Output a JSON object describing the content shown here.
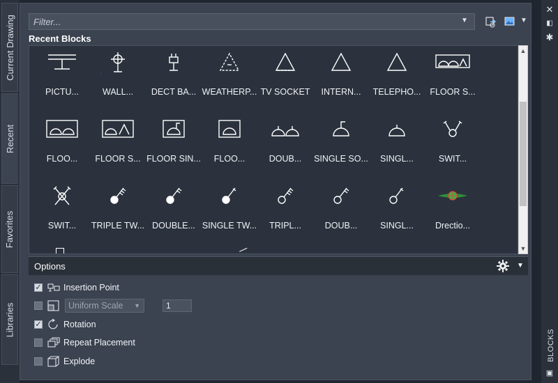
{
  "left_tabs": [
    {
      "label": "Current Drawing",
      "active": false
    },
    {
      "label": "Recent",
      "active": true
    },
    {
      "label": "Favorites",
      "active": false
    },
    {
      "label": "Libraries",
      "active": false
    }
  ],
  "filter": {
    "placeholder": "Filter..."
  },
  "section_title": "Recent Blocks",
  "blocks": [
    {
      "label": "PICTU...",
      "icon": "picture-rail-icon"
    },
    {
      "label": "WALL...",
      "icon": "wall-crosshair-icon"
    },
    {
      "label": "DECT BA...",
      "icon": "dect-base-plug-icon"
    },
    {
      "label": "WEATHERP...",
      "icon": "weatherproof-triangle-icon"
    },
    {
      "label": "TV SOCKET",
      "icon": "tv-socket-triangle-icon"
    },
    {
      "label": "INTERN...",
      "icon": "internet-triangle-icon"
    },
    {
      "label": "TELEPHO...",
      "icon": "telephone-triangle-icon"
    },
    {
      "label": "FLOOR S...",
      "icon": "floor-socket-box-icon"
    },
    {
      "label": "FLOO...",
      "icon": "floor-double-socket-icon"
    },
    {
      "label": "FLOOR S...",
      "icon": "floor-socket-box-icon"
    },
    {
      "label": "FLOOR SIN...",
      "icon": "floor-single-socket-icon"
    },
    {
      "label": "FLOO...",
      "icon": "floor-single-socket-icon"
    },
    {
      "label": "DOUB...",
      "icon": "double-socket-icon"
    },
    {
      "label": "SINGLE SO...",
      "icon": "single-socket-switched-icon"
    },
    {
      "label": "SINGL...",
      "icon": "single-socket-icon"
    },
    {
      "label": "SWIT...",
      "icon": "switch-open-icon"
    },
    {
      "label": "SWIT...",
      "icon": "switch-cross-icon"
    },
    {
      "label": "TRIPLE TW...",
      "icon": "triple-twoway-switch-icon"
    },
    {
      "label": "DOUBLE...",
      "icon": "double-switch-icon"
    },
    {
      "label": "SINGLE TW...",
      "icon": "single-twoway-switch-icon"
    },
    {
      "label": "TRIPL...",
      "icon": "triple-switch-icon"
    },
    {
      "label": "DOUB...",
      "icon": "double-switch-open-icon"
    },
    {
      "label": "SINGL...",
      "icon": "single-switch-icon"
    },
    {
      "label": "Drectio...",
      "icon": "direction-marker-icon"
    }
  ],
  "options": {
    "title": "Options",
    "insertion_point": {
      "label": "Insertion Point",
      "checked": true
    },
    "uniform_scale": {
      "label": "Uniform Scale",
      "checked": false,
      "value": "1"
    },
    "rotation": {
      "label": "Rotation",
      "checked": true
    },
    "repeat_placement": {
      "label": "Repeat Placement",
      "checked": false
    },
    "explode": {
      "label": "Explode",
      "checked": false
    }
  },
  "right_strip": {
    "label": "BLOCKS"
  },
  "colors": {
    "panel_bg": "#3b4350",
    "grid_bg": "#2b323d",
    "accent_green": "#3cb043"
  }
}
